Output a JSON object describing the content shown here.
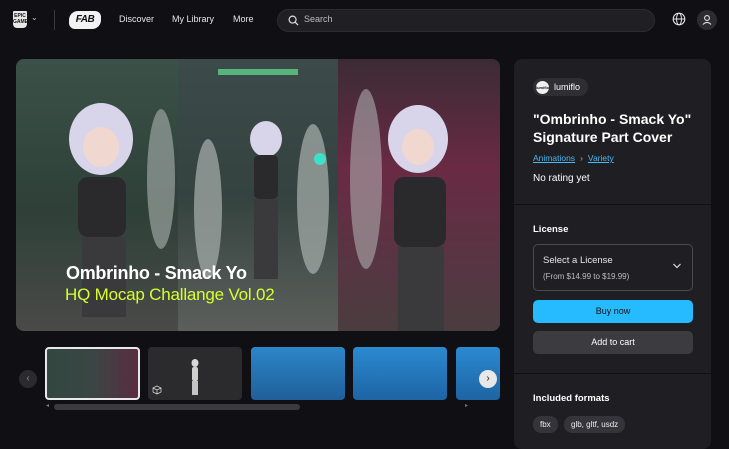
{
  "nav": {
    "epic_logo_text": "EPIC GAMES",
    "fab_logo_text": "FAB",
    "links": [
      "Discover",
      "My Library",
      "More"
    ],
    "search_placeholder": "Search"
  },
  "hero": {
    "title": "Ombrinho - Smack Yo",
    "subtitle": "HQ Mocap Challange Vol.02"
  },
  "product": {
    "creator": "lumiflo",
    "creator_logo_text": "lumiflo",
    "title": "\"Ombrinho - Smack Yo\" Signature Part Cover",
    "breadcrumbs": [
      "Animations",
      "Variety"
    ],
    "rating": "No rating yet",
    "license_heading": "License",
    "license_select": "Select a License",
    "license_price": "(From $14.99 to $19.99)",
    "buy_label": "Buy now",
    "cart_label": "Add to cart",
    "formats_heading": "Included formats",
    "formats": [
      "fbx",
      "glb, gltf, usdz"
    ]
  },
  "colors": {
    "accent": "#26bbff",
    "subtitle": "#d7ff2e",
    "link": "#4bb8f2"
  }
}
